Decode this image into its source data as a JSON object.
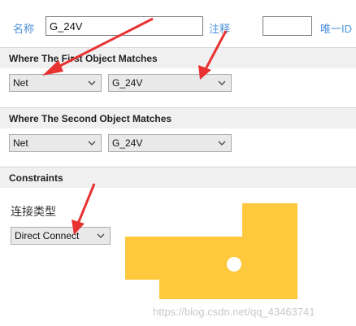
{
  "header": {
    "name_label": "名称",
    "name_value": "G_24V",
    "comment_label": "注释",
    "comment_value": "",
    "uid_label": "唯一ID"
  },
  "first_match": {
    "title": "Where The First Object Matches",
    "type_value": "Net",
    "net_value": "G_24V"
  },
  "second_match": {
    "title": "Where The Second Object Matches",
    "type_value": "Net",
    "net_value": "G_24V"
  },
  "constraints": {
    "title": "Constraints",
    "connect_type_label": "连接类型",
    "connect_type_value": "Direct Connect"
  },
  "watermark": "https://blog.csdn.net/qq_43463741",
  "colors": {
    "label_blue": "#4a90d9",
    "pad_yellow": "#ffc83d",
    "annotation_red": "#e83232"
  },
  "icons": {
    "dropdown": "chevron-down-icon",
    "annotation": "red-arrow-icon"
  }
}
